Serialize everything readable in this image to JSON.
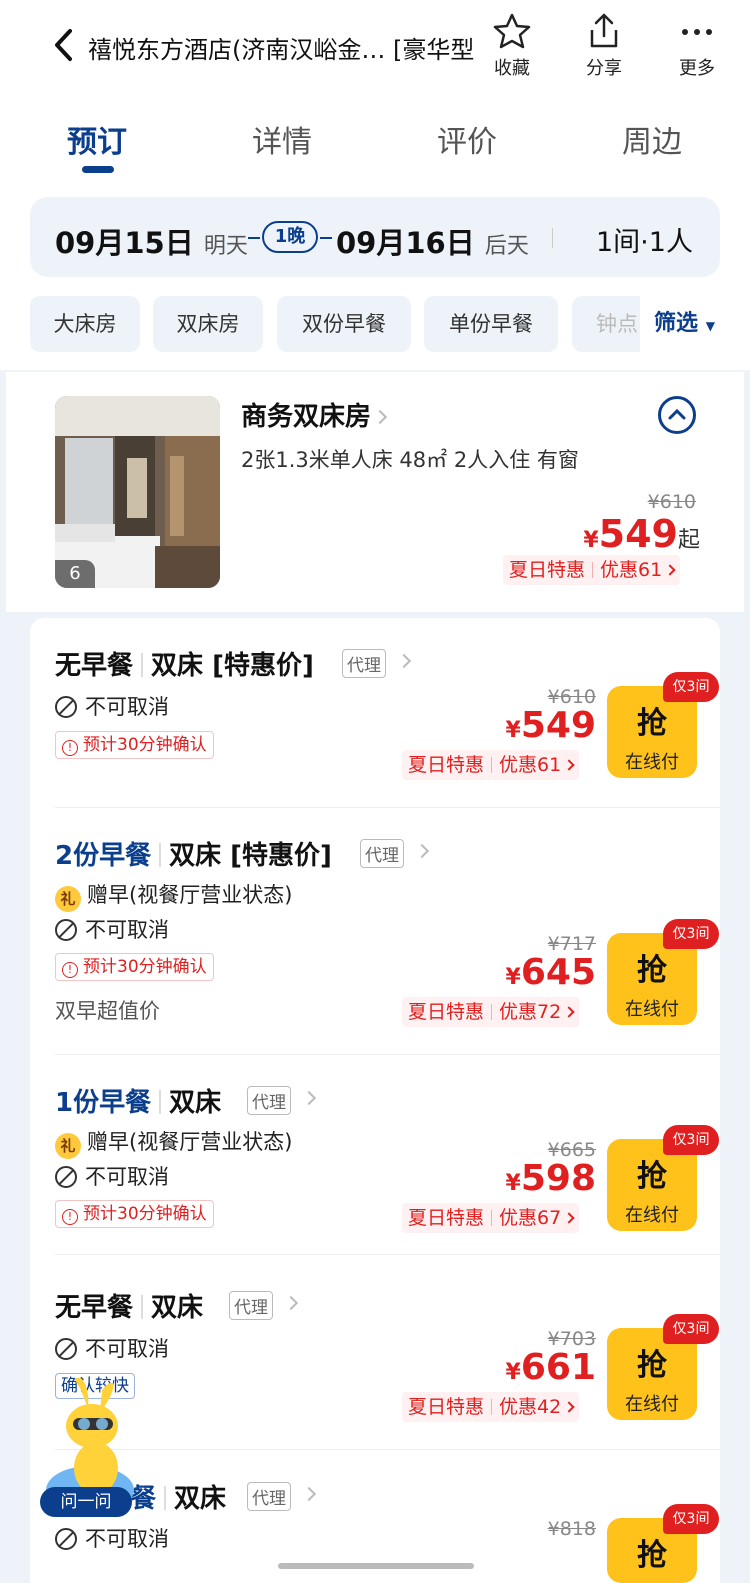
{
  "header": {
    "title": "禧悦东方酒店(济南汉峪金… [豪华型",
    "favorite_label": "收藏",
    "share_label": "分享",
    "more_label": "更多"
  },
  "tabs": [
    "预订",
    "详情",
    "评价",
    "周边"
  ],
  "dates": {
    "checkin": "09月15日",
    "checkin_day": "明天",
    "nights": "1晚",
    "checkout": "09月16日",
    "checkout_day": "后天",
    "rooms_guests": "1间·1人"
  },
  "filters": {
    "chips": [
      "大床房",
      "双床房",
      "双份早餐",
      "单份早餐",
      "钟点"
    ],
    "filter_label": "筛选"
  },
  "room": {
    "name": "商务双床房",
    "info": "2张1.3米单人床  48㎡  2人入住  有窗",
    "photo_count": "6",
    "original_price": "¥610",
    "currency": "¥",
    "price": "549",
    "from": "起",
    "promo_name": "夏日特惠",
    "promo_discount": "优惠61"
  },
  "options": [
    {
      "meal": "无早餐",
      "bed": "双床 [特惠价]",
      "agent": "代理",
      "cancel": "不可取消",
      "confirm": "预计30分钟确认",
      "original_price": "¥610",
      "price": "549",
      "promo_name": "夏日特惠",
      "promo_discount": "优惠61",
      "grab": "抢",
      "pay": "在线付",
      "stock": "仅3间"
    },
    {
      "meal": "2份早餐",
      "bed": "双床 [特惠价]",
      "agent": "代理",
      "gift": "礼",
      "gift_text": "赠早(视餐厅营业状态)",
      "cancel": "不可取消",
      "confirm": "预计30分钟确认",
      "note": "双早超值价",
      "original_price": "¥717",
      "price": "645",
      "promo_name": "夏日特惠",
      "promo_discount": "优惠72",
      "grab": "抢",
      "pay": "在线付",
      "stock": "仅3间"
    },
    {
      "meal": "1份早餐",
      "bed": "双床",
      "agent": "代理",
      "gift": "礼",
      "gift_text": "赠早(视餐厅营业状态)",
      "cancel": "不可取消",
      "confirm": "预计30分钟确认",
      "original_price": "¥665",
      "price": "598",
      "promo_name": "夏日特惠",
      "promo_discount": "优惠67",
      "grab": "抢",
      "pay": "在线付",
      "stock": "仅3间"
    },
    {
      "meal": "无早餐",
      "bed": "双床",
      "agent": "代理",
      "cancel": "不可取消",
      "fast": "确认较快",
      "original_price": "¥703",
      "price": "661",
      "promo_name": "夏日特惠",
      "promo_discount": "优惠42",
      "grab": "抢",
      "pay": "在线付",
      "stock": "仅3间"
    },
    {
      "meal": "餐",
      "bed": "双床",
      "agent": "代理",
      "cancel": "不可取消",
      "original_price": "¥818",
      "grab": "抢",
      "stock": "仅3间"
    }
  ],
  "assistant": {
    "label": "问一问"
  },
  "colors": {
    "brand_blue": "#0b3e8c",
    "price_red": "#e02020",
    "grab_yellow": "#ffc21a"
  }
}
